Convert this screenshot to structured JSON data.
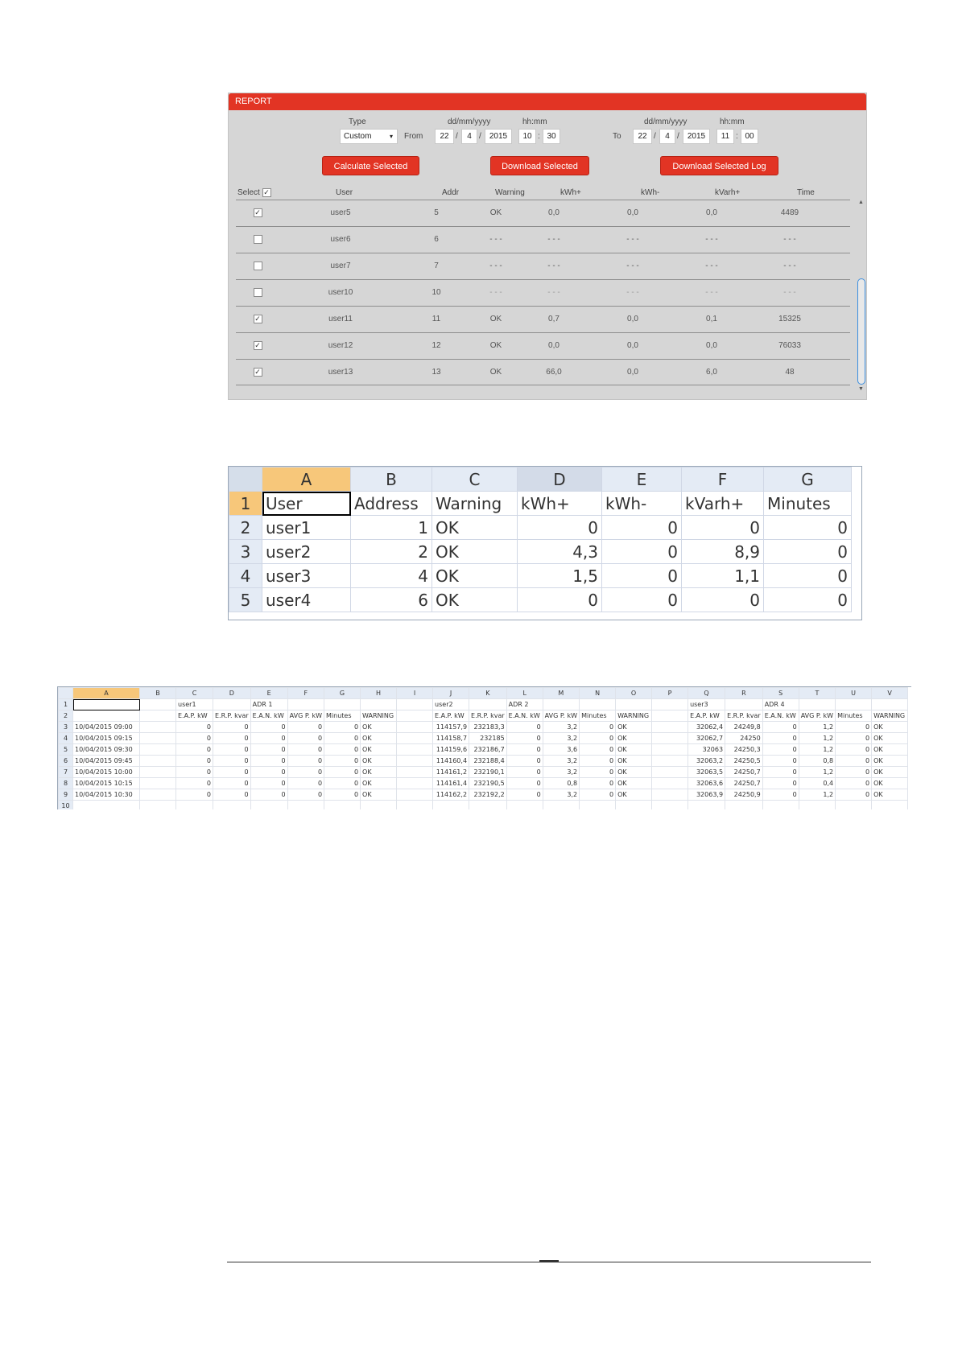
{
  "report": {
    "title": "REPORT",
    "labels": {
      "type": "Type",
      "date_fmt": "dd/mm/yyyy",
      "time_fmt": "hh:mm",
      "from": "From",
      "to": "To"
    },
    "type_value": "Custom",
    "from": {
      "day": "22",
      "month": "4",
      "year": "2015",
      "hour": "10",
      "minute": "30"
    },
    "to": {
      "day": "22",
      "month": "4",
      "year": "2015",
      "hour": "11",
      "minute": "00"
    },
    "separators": {
      "date": "/",
      "time": ":"
    },
    "buttons": {
      "calculate": "Calculate Selected",
      "download": "Download Selected",
      "download_log": "Download Selected Log"
    },
    "columns": {
      "select": "Select",
      "user": "User",
      "addr": "Addr",
      "warning": "Warning",
      "kwh_plus": "kWh+",
      "kwh_minus": "kWh-",
      "kvarh_plus": "kVarh+",
      "time": "Time"
    },
    "rows": [
      {
        "checked": true,
        "user": "user5",
        "addr": "5",
        "warning": "OK",
        "kwh_plus": "0,0",
        "kwh_minus": "0,0",
        "kvarh_plus": "0,0",
        "time": "4489"
      },
      {
        "checked": false,
        "user": "user6",
        "addr": "6",
        "warning": "- - -",
        "kwh_plus": "- - -",
        "kwh_minus": "- - -",
        "kvarh_plus": "- - -",
        "time": "- - -"
      },
      {
        "checked": false,
        "user": "user7",
        "addr": "7",
        "warning": "- - -",
        "kwh_plus": "- - -",
        "kwh_minus": "- - -",
        "kvarh_plus": "- - -",
        "time": "- - -"
      },
      {
        "checked": false,
        "user": "user10",
        "addr": "10",
        "warning": "- - -",
        "kwh_plus": "- - -",
        "kwh_minus": "- - -",
        "kvarh_plus": "- - -",
        "time": "- - -"
      },
      {
        "checked": true,
        "user": "user11",
        "addr": "11",
        "warning": "OK",
        "kwh_plus": "0,7",
        "kwh_minus": "0,0",
        "kvarh_plus": "0,1",
        "time": "15325"
      },
      {
        "checked": true,
        "user": "user12",
        "addr": "12",
        "warning": "OK",
        "kwh_plus": "0,0",
        "kwh_minus": "0,0",
        "kvarh_plus": "0,0",
        "time": "76033"
      },
      {
        "checked": true,
        "user": "user13",
        "addr": "13",
        "warning": "OK",
        "kwh_plus": "66,0",
        "kwh_minus": "0,0",
        "kvarh_plus": "6,0",
        "time": "48"
      }
    ]
  },
  "sheet1": {
    "col_headers": [
      "A",
      "B",
      "C",
      "D",
      "E",
      "F",
      "G"
    ],
    "rows": [
      {
        "n": "1",
        "cells": [
          "User",
          "Address",
          "Warning",
          "kWh+",
          "kWh-",
          "kVarh+",
          "Minutes"
        ]
      },
      {
        "n": "2",
        "cells": [
          "user1",
          "1",
          "OK",
          "0",
          "0",
          "0",
          "0"
        ]
      },
      {
        "n": "3",
        "cells": [
          "user2",
          "2",
          "OK",
          "4,3",
          "0",
          "8,9",
          "0"
        ]
      },
      {
        "n": "4",
        "cells": [
          "user3",
          "4",
          "OK",
          "1,5",
          "0",
          "1,1",
          "0"
        ]
      },
      {
        "n": "5",
        "cells": [
          "user4",
          "6",
          "OK",
          "0",
          "0",
          "0",
          "0"
        ]
      }
    ]
  },
  "sheet2": {
    "col_headers": [
      "A",
      "B",
      "C",
      "D",
      "E",
      "F",
      "G",
      "H",
      "I",
      "J",
      "K",
      "L",
      "M",
      "N",
      "O",
      "P",
      "Q",
      "R",
      "S",
      "T",
      "U",
      "V"
    ],
    "rows": [
      {
        "n": "1",
        "cells": [
          "",
          "",
          "user1",
          "",
          "ADR 1",
          "",
          "",
          "",
          "",
          "user2",
          "",
          "ADR 2",
          "",
          "",
          "",
          "",
          "user3",
          "",
          "ADR 4",
          "",
          "",
          ""
        ]
      },
      {
        "n": "2",
        "cells": [
          "",
          "",
          "E.A.P. kW",
          "E.R.P. kvar",
          "E.A.N. kW",
          "AVG P. kW",
          "Minutes",
          "WARNING",
          "",
          "E.A.P. kW",
          "E.R.P. kvar",
          "E.A.N. kW",
          "AVG P. kW",
          "Minutes",
          "WARNING",
          "",
          "E.A.P. kW",
          "E.R.P. kvar",
          "E.A.N. kW",
          "AVG P. kW",
          "Minutes",
          "WARNING"
        ]
      },
      {
        "n": "3",
        "cells": [
          "10/04/2015 09:00",
          "",
          "0",
          "0",
          "0",
          "0",
          "0",
          "OK",
          "",
          "114157,9",
          "232183,3",
          "0",
          "3,2",
          "0",
          "OK",
          "",
          "32062,4",
          "24249,8",
          "0",
          "1,2",
          "0",
          "OK"
        ]
      },
      {
        "n": "4",
        "cells": [
          "10/04/2015 09:15",
          "",
          "0",
          "0",
          "0",
          "0",
          "0",
          "OK",
          "",
          "114158,7",
          "232185",
          "0",
          "3,2",
          "0",
          "OK",
          "",
          "32062,7",
          "24250",
          "0",
          "1,2",
          "0",
          "OK"
        ]
      },
      {
        "n": "5",
        "cells": [
          "10/04/2015 09:30",
          "",
          "0",
          "0",
          "0",
          "0",
          "0",
          "OK",
          "",
          "114159,6",
          "232186,7",
          "0",
          "3,6",
          "0",
          "OK",
          "",
          "32063",
          "24250,3",
          "0",
          "1,2",
          "0",
          "OK"
        ]
      },
      {
        "n": "6",
        "cells": [
          "10/04/2015 09:45",
          "",
          "0",
          "0",
          "0",
          "0",
          "0",
          "OK",
          "",
          "114160,4",
          "232188,4",
          "0",
          "3,2",
          "0",
          "OK",
          "",
          "32063,2",
          "24250,5",
          "0",
          "0,8",
          "0",
          "OK"
        ]
      },
      {
        "n": "7",
        "cells": [
          "10/04/2015 10:00",
          "",
          "0",
          "0",
          "0",
          "0",
          "0",
          "OK",
          "",
          "114161,2",
          "232190,1",
          "0",
          "3,2",
          "0",
          "OK",
          "",
          "32063,5",
          "24250,7",
          "0",
          "1,2",
          "0",
          "OK"
        ]
      },
      {
        "n": "8",
        "cells": [
          "10/04/2015 10:15",
          "",
          "0",
          "0",
          "0",
          "0",
          "0",
          "OK",
          "",
          "114161,4",
          "232190,5",
          "0",
          "0,8",
          "0",
          "OK",
          "",
          "32063,6",
          "24250,7",
          "0",
          "0,4",
          "0",
          "OK"
        ]
      },
      {
        "n": "9",
        "cells": [
          "10/04/2015 10:30",
          "",
          "0",
          "0",
          "0",
          "0",
          "0",
          "OK",
          "",
          "114162,2",
          "232192,2",
          "0",
          "3,2",
          "0",
          "OK",
          "",
          "32063,9",
          "24250,9",
          "0",
          "1,2",
          "0",
          "OK"
        ]
      },
      {
        "n": "10",
        "cells": [
          "",
          "",
          "",
          "",
          "",
          "",
          "",
          "",
          "",
          "",
          "",
          "",
          "",
          "",
          "",
          "",
          "",
          "",
          "",
          "",
          "",
          ""
        ]
      }
    ]
  },
  "icons": {
    "checkbox_checked": "✓",
    "caret_down": "▾",
    "scroll_up": "▲",
    "scroll_down": "▼"
  },
  "colors": {
    "accent": "#e23424",
    "panel_bg": "#d6d6d6",
    "selected_header": "#f7c77a",
    "scroll_thumb": "#3c8fe0"
  }
}
